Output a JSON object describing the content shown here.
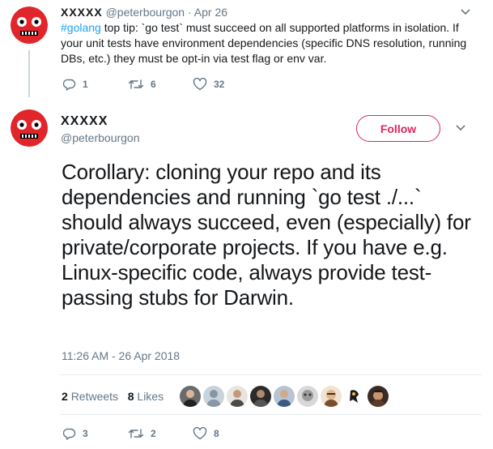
{
  "parent_tweet": {
    "name": "XXXXX",
    "handle": "@peterbourgon",
    "separator": "·",
    "date": "Apr 26",
    "hashtag": "#golang",
    "text": " top tip: `go test` must succeed on all supported platforms in isolation. If your unit tests have environment dependencies (specific DNS resolution, running DBs, etc.) they must be opt-in via test flag or env var.",
    "replies": "1",
    "retweets": "6",
    "likes": "32"
  },
  "main_tweet": {
    "name": "XXXXX",
    "handle": "@peterbourgon",
    "follow_label": "Follow",
    "text": "Corollary: cloning your repo and its dependencies and running `go test ./...` should always succeed, even (especially) for private/corporate projects. If you have e.g. Linux-specific code, always provide test-passing stubs for Darwin.",
    "timestamp": "11:26 AM - 26 Apr 2018",
    "retweet_count": "2",
    "retweet_label": "Retweets",
    "like_count": "8",
    "like_label": "Likes",
    "replies": "3",
    "retweets": "2",
    "likes": "8"
  },
  "colors": {
    "accent_blue": "#1da1f2",
    "follow_red": "#e0245e",
    "muted": "#657786",
    "avatar_red": "#e0262b"
  },
  "icons": [
    "reply-icon",
    "retweet-icon",
    "heart-icon",
    "chevron-down-icon"
  ]
}
